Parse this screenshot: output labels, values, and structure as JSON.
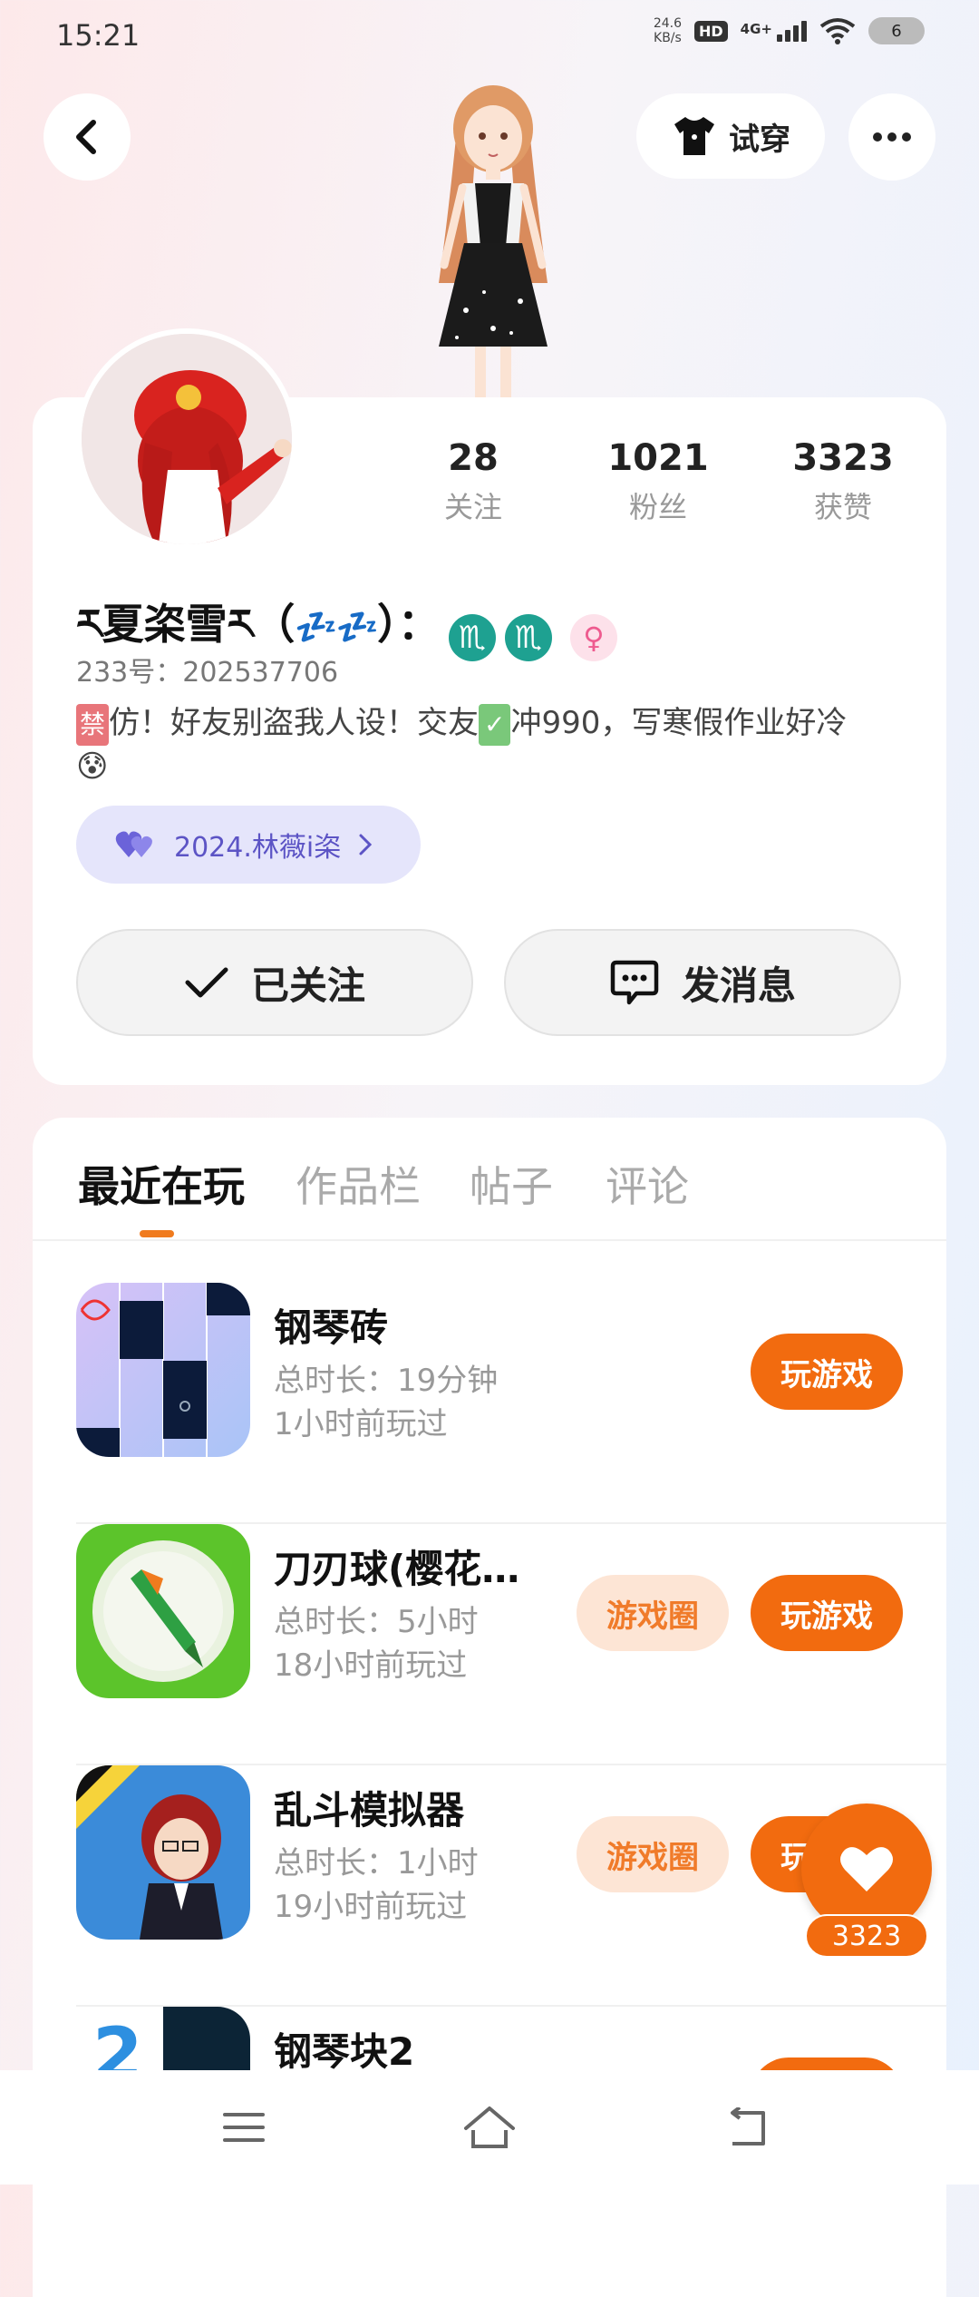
{
  "status_bar": {
    "time": "15:21",
    "net_speed_value": "24.6",
    "net_speed_unit": "KB/s",
    "hd_label": "HD",
    "signal_label": "4G+",
    "battery": "6"
  },
  "header": {
    "tryon_label": "试穿"
  },
  "profile": {
    "stats": [
      {
        "value": "28",
        "label": "关注"
      },
      {
        "value": "1021",
        "label": "粉丝"
      },
      {
        "value": "3323",
        "label": "获赞"
      }
    ],
    "nickname": "ར夏栥雪ར（",
    "nickname_zzz": "💤💤",
    "nickname_end": "）：",
    "zodiac_icons": [
      "♏",
      "♏"
    ],
    "gender_icon": "♀",
    "user_id": "233号：202537706",
    "bio_tag": "禁",
    "bio_part1": "仿！好友别盗我人设！交友",
    "bio_check": "✓",
    "bio_part2": "冲990，写寒假作业好冷",
    "bio_emoji": "😰",
    "badge_label": "2024.林薇i栥",
    "follow_label": "已关注",
    "message_label": "发消息"
  },
  "tabs": [
    {
      "label": "最近在玩",
      "active": true
    },
    {
      "label": "作品栏",
      "active": false
    },
    {
      "label": "帖子",
      "active": false
    },
    {
      "label": "评论",
      "active": false
    }
  ],
  "games": [
    {
      "title": "钢琴砖",
      "duration": "总时长：19分钟",
      "last_played": "1小时前玩过",
      "has_circle": false,
      "icon": "piano-tiles-icon"
    },
    {
      "title": "刀刃球(樱花校...",
      "duration": "总时长：5小时",
      "last_played": "18小时前玩过",
      "has_circle": true,
      "icon": "blade-ball-icon"
    },
    {
      "title": "乱斗模拟器",
      "duration": "总时长：1小时",
      "last_played": "19小时前玩过",
      "has_circle": true,
      "icon": "brawl-simulator-icon"
    },
    {
      "title": "钢琴块2",
      "duration": "",
      "last_played": "",
      "has_circle": false,
      "icon": "piano-tiles-2-icon"
    }
  ],
  "buttons": {
    "play_label": "玩游戏",
    "circle_label": "游戏圈"
  },
  "like": {
    "count": "3323"
  }
}
